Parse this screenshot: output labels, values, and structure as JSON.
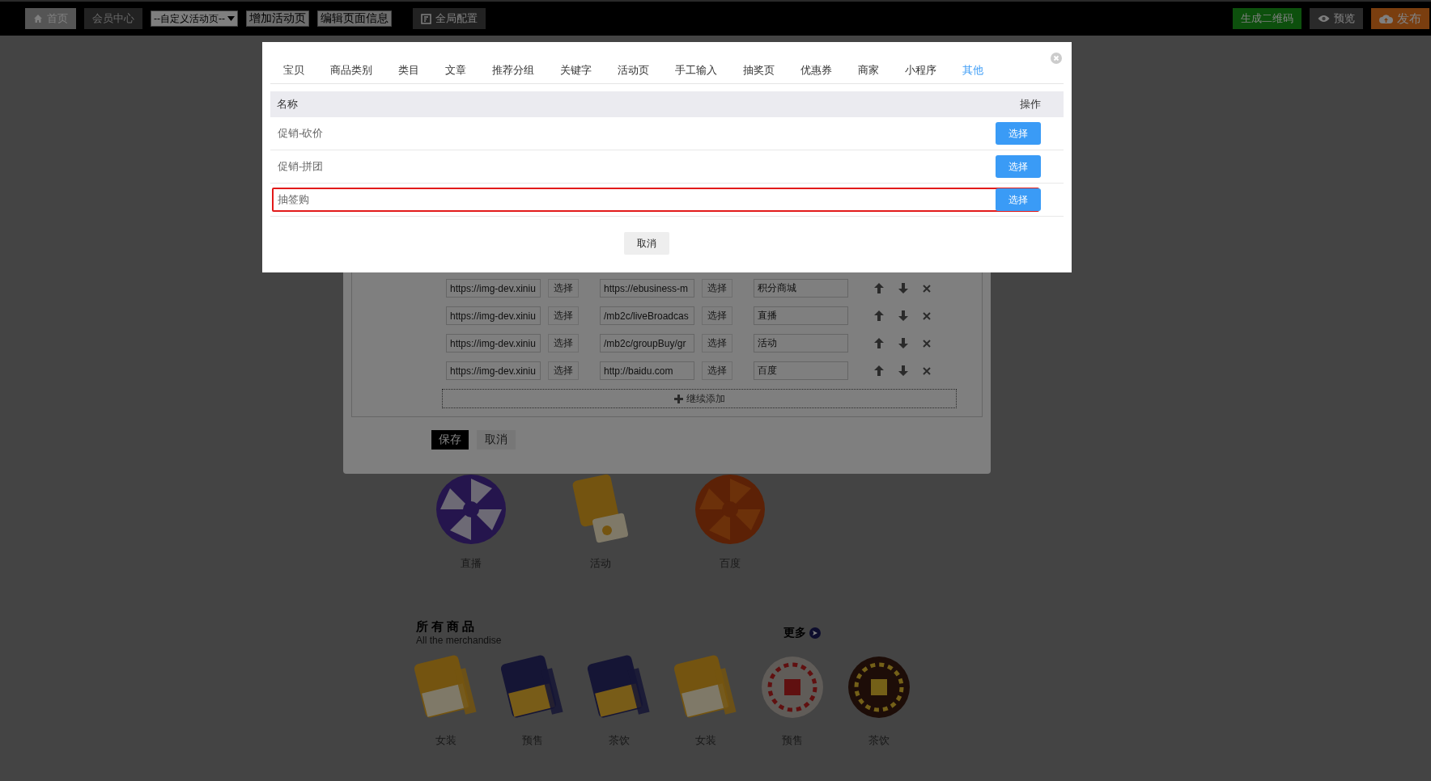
{
  "top_bar": {
    "home": "首页",
    "member_center": "会员中心",
    "page_select": "--自定义活动页--",
    "add_page": "增加活动页",
    "edit_page_info": "编辑页面信息",
    "global_config": "全局配置",
    "qr_code": "生成二维码",
    "preview": "预览",
    "publish": "发布"
  },
  "link_dialog": {
    "tabs": [
      {
        "label": "宝贝",
        "selected": false
      },
      {
        "label": "商品类别",
        "selected": false
      },
      {
        "label": "类目",
        "selected": false
      },
      {
        "label": "文章",
        "selected": false
      },
      {
        "label": "推荐分组",
        "selected": false
      },
      {
        "label": "关键字",
        "selected": false
      },
      {
        "label": "活动页",
        "selected": false
      },
      {
        "label": "手工输入",
        "selected": false
      },
      {
        "label": "抽奖页",
        "selected": false
      },
      {
        "label": "优惠券",
        "selected": false
      },
      {
        "label": "商家",
        "selected": false
      },
      {
        "label": "小程序",
        "selected": false
      },
      {
        "label": "其他",
        "selected": true
      }
    ],
    "columns": [
      "名称",
      "操作"
    ],
    "rows": [
      {
        "name": "促销-砍价",
        "action": "选择",
        "highlighted": false
      },
      {
        "name": "促销-拼团",
        "action": "选择",
        "highlighted": false
      },
      {
        "name": "抽签购",
        "action": "选择",
        "highlighted": true
      }
    ],
    "cancel": "取消"
  },
  "nav_editor": {
    "rows": [
      {
        "image_url": "https://img-dev.xiniu",
        "image_button": "选择",
        "link": "https://ebusiness-m",
        "link_button": "选择",
        "title": "积分商城"
      },
      {
        "image_url": "https://img-dev.xiniu",
        "image_button": "选择",
        "link": "/mb2c/liveBroadcas",
        "link_button": "选择",
        "title": "直播"
      },
      {
        "image_url": "https://img-dev.xiniu",
        "image_button": "选择",
        "link": "/mb2c/groupBuy/gr",
        "link_button": "选择",
        "title": "活动"
      },
      {
        "image_url": "https://img-dev.xiniu",
        "image_button": "选择",
        "link": "http://baidu.com",
        "link_button": "选择",
        "title": "百度"
      }
    ],
    "add_more": "继续添加",
    "save": "保存",
    "cancel": "取消"
  },
  "page_preview": {
    "nav_items": [
      {
        "label": "直播"
      },
      {
        "label": "活动"
      },
      {
        "label": "百度"
      }
    ],
    "section": {
      "title": "所有商品",
      "subtitle": "All the merchandise",
      "more": "更多"
    },
    "products": [
      {
        "label": "女装"
      },
      {
        "label": "预售"
      },
      {
        "label": "茶饮"
      },
      {
        "label": "女装"
      },
      {
        "label": "预售"
      },
      {
        "label": "茶饮"
      }
    ]
  }
}
